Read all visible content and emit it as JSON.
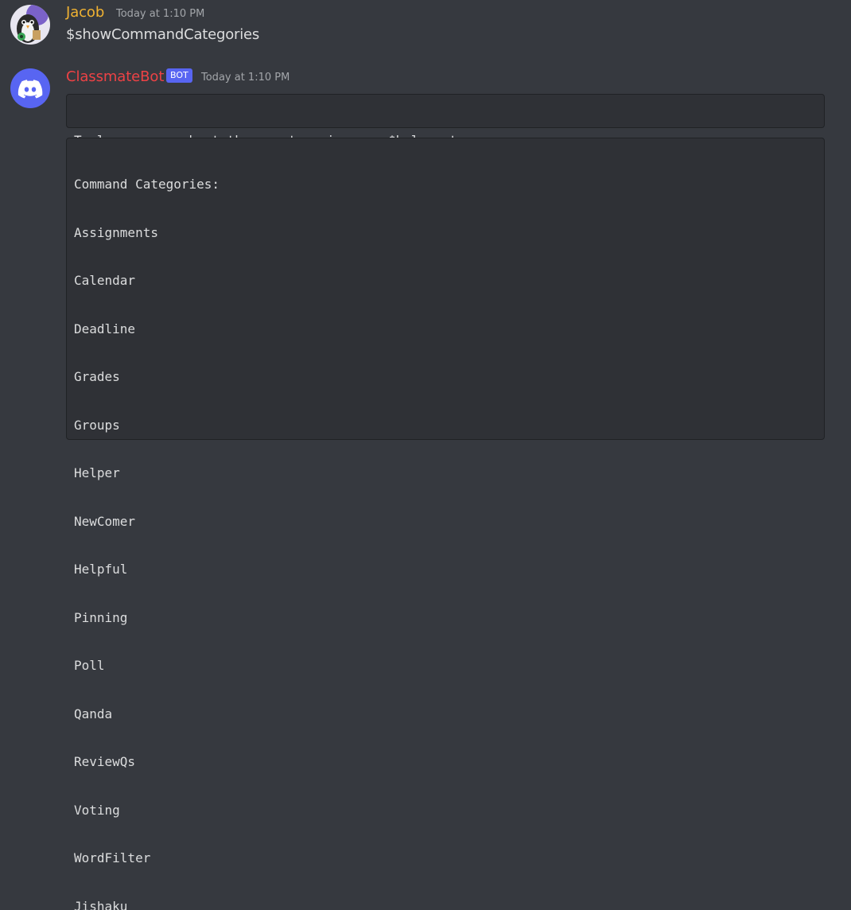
{
  "messages": [
    {
      "author": "Jacob",
      "author_color": "#f0b232",
      "timestamp": "Today at 1:10 PM",
      "content": "$showCommandCategories",
      "avatar": "penguin-avatar"
    },
    {
      "author": "ClassmateBot",
      "author_color": "#ed4245",
      "bot_tag": "BOT",
      "timestamp": "Today at 1:10 PM",
      "avatar": "discord-logo-avatar",
      "code_blocks": [
        {
          "lines": [
            "To learn more about these categories run $help category_name"
          ]
        },
        {
          "lines": [
            "Command Categories:",
            "Assignments",
            "Calendar",
            "Deadline",
            "Grades",
            "Groups",
            "Helper",
            "NewComer",
            "Helpful",
            "Pinning",
            "Poll",
            "Qanda",
            "ReviewQs",
            "Voting",
            "WordFilter",
            "Jishaku"
          ]
        }
      ]
    }
  ],
  "colors": {
    "background": "#36393f",
    "codeblock_bg": "#2f3136",
    "bot_tag": "#5865f2",
    "discord_blurple": "#5865f2"
  }
}
